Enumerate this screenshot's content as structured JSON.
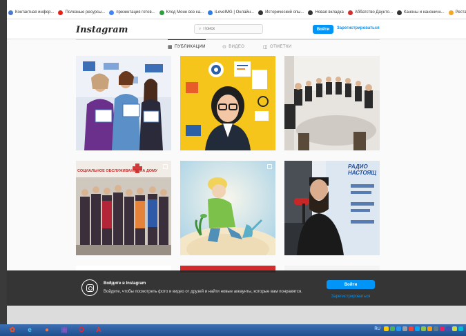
{
  "browser": {
    "bookmarks": [
      {
        "label": "Контактная инфор...",
        "icon": "doc-icon",
        "color": "#4a7bd1"
      },
      {
        "label": "Полезные ресурсы...",
        "icon": "youtube-icon",
        "color": "#e62117"
      },
      {
        "label": "презентация готов...",
        "icon": "google-icon",
        "color": "#4285f4"
      },
      {
        "label": "Клод Моне все ка...",
        "icon": "play-icon",
        "color": "#2e9d3e"
      },
      {
        "label": "iLoveIMG | Онлайн...",
        "icon": "heart-icon",
        "color": "#2f7de1"
      },
      {
        "label": "Исторический опы...",
        "icon": "globe-icon",
        "color": "#333333"
      },
      {
        "label": "Новая вкладка",
        "icon": "globe-icon",
        "color": "#333333"
      },
      {
        "label": "Аббатство Даунто...",
        "icon": "star-icon",
        "color": "#d32f2f"
      },
      {
        "label": "Каноны и каноничн...",
        "icon": "globe-icon",
        "color": "#333333"
      },
      {
        "label": "Реставрация",
        "icon": "p-icon",
        "color": "#f5a623"
      }
    ]
  },
  "header": {
    "logo": "Instagram",
    "search_placeholder": "Поиск",
    "login_label": "Войти",
    "register_label": "Зарегистрироваться"
  },
  "tabs": [
    {
      "label": "ПУБЛИКАЦИИ",
      "icon": "grid-icon",
      "active": true
    },
    {
      "label": "ВИДЕО",
      "icon": "video-icon",
      "active": false
    },
    {
      "label": "ОТМЕТКИ",
      "icon": "tag-icon",
      "active": false
    }
  ],
  "posts": [
    {
      "name": "post-award-ceremony",
      "multi": false
    },
    {
      "name": "post-illustration-woman",
      "multi": false
    },
    {
      "name": "post-meeting-circle",
      "multi": false
    },
    {
      "name": "post-social-service",
      "multi": true,
      "caption": "СОЦИАЛЬНОЕ ОБСЛУЖИВАНИЕ НА ДОМУ"
    },
    {
      "name": "post-little-prince",
      "multi": true
    },
    {
      "name": "post-radio-interview",
      "multi": false,
      "caption": "РАДИО НАСТОЯЩ"
    }
  ],
  "banner": {
    "title": "Войдите в Instagram",
    "text": "Войдите, чтобы посмотреть фото и видео от друзей и найти новые аккаунты, которые вам понравятся.",
    "login_label": "Войти",
    "register_label": "Зарегистрироваться"
  },
  "taskbar": {
    "apps": [
      {
        "name": "windows-start-icon",
        "glyph": "✿",
        "color": "#f25022"
      },
      {
        "name": "internet-explorer-icon",
        "glyph": "e",
        "color": "#4fc3f7"
      },
      {
        "name": "firefox-icon",
        "glyph": "●",
        "color": "#ff7139"
      },
      {
        "name": "pdf-editor-icon",
        "glyph": "▣",
        "color": "#7e57c2"
      },
      {
        "name": "opera-icon",
        "glyph": "O",
        "color": "#ff1b2d"
      },
      {
        "name": "acrobat-icon",
        "glyph": "A",
        "color": "#e53935"
      }
    ],
    "lang": "RU",
    "tray_colors": [
      "#ffcc00",
      "#4caf50",
      "#2196f3",
      "#9e9e9e",
      "#f44336",
      "#03a9f4",
      "#8bc34a",
      "#ff9800",
      "#607d8b",
      "#e91e63",
      "#3f51b5",
      "#cddc39",
      "#00bcd4"
    ]
  }
}
